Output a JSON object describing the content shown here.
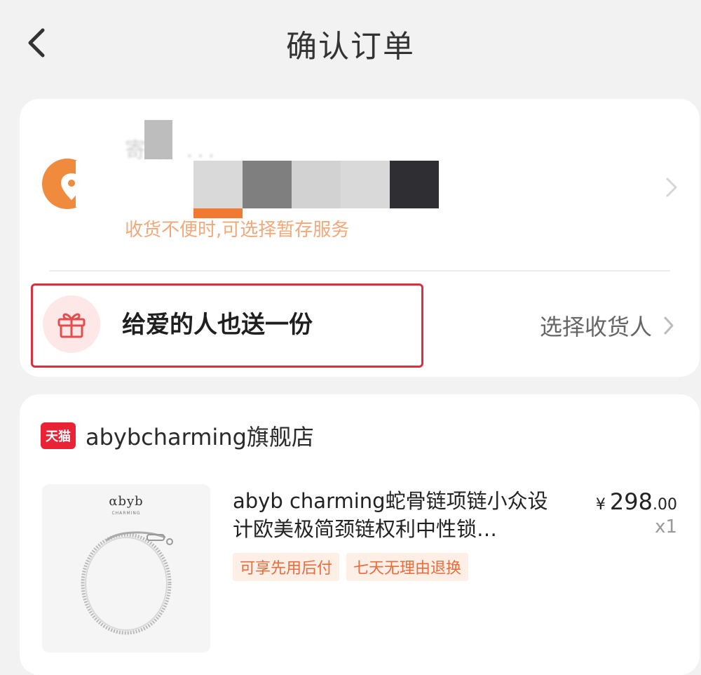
{
  "header": {
    "title": "确认订单"
  },
  "address": {
    "masked_label": "寄给 ...",
    "note": "收货不便时,可选择暂存服务"
  },
  "gift": {
    "label": "给爱的人也送一份",
    "action_label": "选择收货人"
  },
  "store": {
    "badge": "天猫",
    "name": "abybcharming旗舰店"
  },
  "product": {
    "brand": "αbyb",
    "brand_sub": "CHARMING",
    "title": "abyb charming蛇骨链项链小众设计欧美极简颈链权利中性锁…",
    "tags": [
      "可享先用后付",
      "七天无理由退换"
    ],
    "price_symbol": "¥",
    "price_int": "298",
    "price_dec": ".00",
    "quantity": "x1"
  },
  "colors": {
    "accent_orange": "#f08a3c",
    "highlight_red": "#d9313b",
    "tmall_red": "#e92335",
    "tag_text": "#ec6b3a"
  }
}
